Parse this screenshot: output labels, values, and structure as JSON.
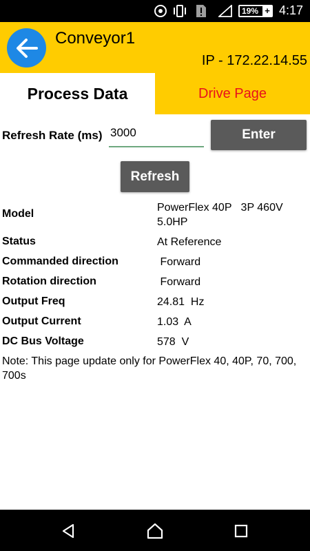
{
  "status_bar": {
    "battery": "19%",
    "time": "4:17",
    "icons": [
      "data-saver-icon",
      "vibrate-icon",
      "alert-sim-icon",
      "signal-icon",
      "battery-charging-icon"
    ]
  },
  "header": {
    "title": "Conveyor1",
    "ip": "IP - 172.22.14.55",
    "accent": "#ffcc00",
    "back_button_color": "#1e88e5"
  },
  "tabs": [
    {
      "label": "Process Data",
      "active": true
    },
    {
      "label": "Drive Page",
      "active": false,
      "color": "#e8111b"
    }
  ],
  "refresh": {
    "label": "Refresh Rate (ms)",
    "value": "3000",
    "enter_label": "Enter",
    "refresh_label": "Refresh"
  },
  "rows": [
    {
      "label": "Model",
      "value": "PowerFlex 40P   3P 460V\n5.0HP"
    },
    {
      "label": "Status",
      "value": "At Reference"
    },
    {
      "label": "Commanded direction",
      "value": " Forward"
    },
    {
      "label": "Rotation direction",
      "value": " Forward"
    },
    {
      "label": "Output Freq",
      "value": "24.81  Hz"
    },
    {
      "label": "Output Current",
      "value": "1.03  A"
    },
    {
      "label": "DC Bus Voltage",
      "value": "578  V"
    }
  ],
  "note": "Note: This page update only for PowerFlex 40, 40P, 70, 700, 700s",
  "nav": [
    "back-icon",
    "home-icon",
    "recents-icon"
  ]
}
